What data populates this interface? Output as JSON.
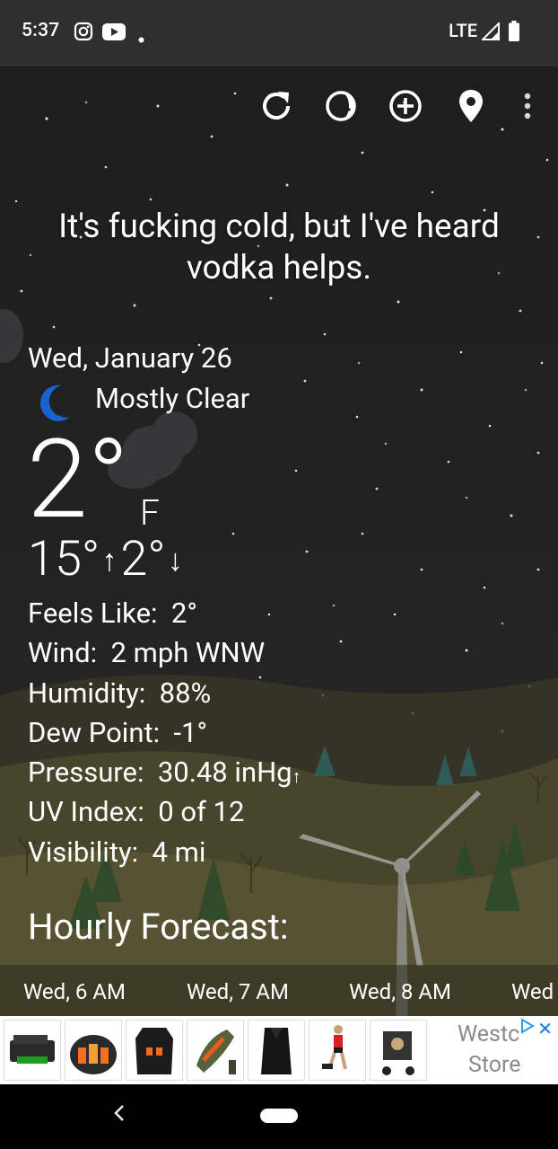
{
  "status_bar": {
    "time": "5:37",
    "network": "LTE",
    "icons": [
      "instagram-icon",
      "youtube-icon",
      "dot-icon",
      "signal-icon",
      "battery-icon"
    ]
  },
  "toolbar": {
    "icons": [
      "refresh-icon",
      "theme-icon",
      "add-location-icon",
      "location-pin-icon",
      "more-vert-icon"
    ]
  },
  "joke": "It's fucking cold, but I've heard vodka helps.",
  "current": {
    "date": "Wed, January 26",
    "condition": "Mostly Clear",
    "temp": "2°",
    "unit": "F",
    "high": "15°",
    "low": "2°",
    "up_arrow": "↑",
    "down_arrow": "↓"
  },
  "details": [
    {
      "label": "Feels Like:",
      "value": "2°"
    },
    {
      "label": "Wind:",
      "value": "2 mph WNW"
    },
    {
      "label": "Humidity:",
      "value": "88%"
    },
    {
      "label": "Dew Point:",
      "value": "-1°"
    },
    {
      "label": "Pressure:",
      "value": "30.48 inHg",
      "trend": "↑"
    },
    {
      "label": "UV Index:",
      "value": "0 of 12"
    },
    {
      "label": "Visibility:",
      "value": "4 mi"
    }
  ],
  "hourly": {
    "title": "Hourly Forecast:",
    "items": [
      "Wed, 6 AM",
      "Wed, 7 AM",
      "Wed, 8 AM",
      "Wed"
    ]
  },
  "ad": {
    "store_line1": "Westc",
    "store_line2": "Store",
    "close": "✕"
  },
  "colors": {
    "sky": "#1e1e1f",
    "statusbar": "#2f2f30",
    "moon": "#1565d8",
    "hills": "#5b5634"
  }
}
